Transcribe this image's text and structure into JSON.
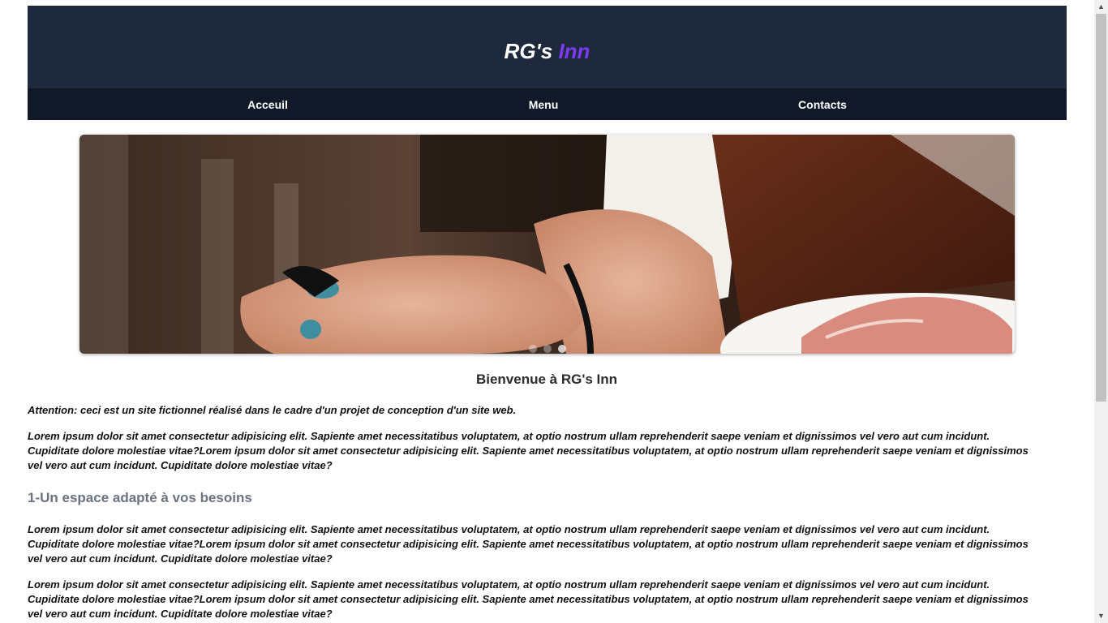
{
  "header": {
    "brand_main": "RG's",
    "brand_accent": "Inn"
  },
  "nav": {
    "items": [
      "Acceuil",
      "Menu",
      "Contacts"
    ]
  },
  "carousel": {
    "slide_count": 3,
    "active_index": 2
  },
  "content": {
    "welcome": "Bienvenue à RG's Inn",
    "note": "Attention: ceci est un site fictionnel réalisé dans le cadre d'un projet de conception d'un site web.",
    "paragraph1": "Lorem ipsum dolor sit amet consectetur adipisicing elit. Sapiente amet necessitatibus voluptatem, at optio nostrum ullam reprehenderit saepe veniam et dignissimos vel vero aut cum incidunt. Cupiditate dolore molestiae vitae?Lorem ipsum dolor sit amet consectetur adipisicing elit. Sapiente amet necessitatibus voluptatem, at optio nostrum ullam reprehenderit saepe veniam et dignissimos vel vero aut cum incidunt. Cupiditate dolore molestiae vitae?",
    "section1_title": "1-Un espace adapté à vos besoins",
    "paragraph2": "Lorem ipsum dolor sit amet consectetur adipisicing elit. Sapiente amet necessitatibus voluptatem, at optio nostrum ullam reprehenderit saepe veniam et dignissimos vel vero aut cum incidunt. Cupiditate dolore molestiae vitae?Lorem ipsum dolor sit amet consectetur adipisicing elit. Sapiente amet necessitatibus voluptatem, at optio nostrum ullam reprehenderit saepe veniam et dignissimos vel vero aut cum incidunt. Cupiditate dolore molestiae vitae?",
    "paragraph3": "Lorem ipsum dolor sit amet consectetur adipisicing elit. Sapiente amet necessitatibus voluptatem, at optio nostrum ullam reprehenderit saepe veniam et dignissimos vel vero aut cum incidunt. Cupiditate dolore molestiae vitae?Lorem ipsum dolor sit amet consectetur adipisicing elit. Sapiente amet necessitatibus voluptatem, at optio nostrum ullam reprehenderit saepe veniam et dignissimos vel vero aut cum incidunt. Cupiditate dolore molestiae vitae?"
  },
  "colors": {
    "header_bg": "#1f293d",
    "nav_bg": "#111827",
    "brand_accent": "#7c3aed",
    "section_title": "#6b7280"
  }
}
